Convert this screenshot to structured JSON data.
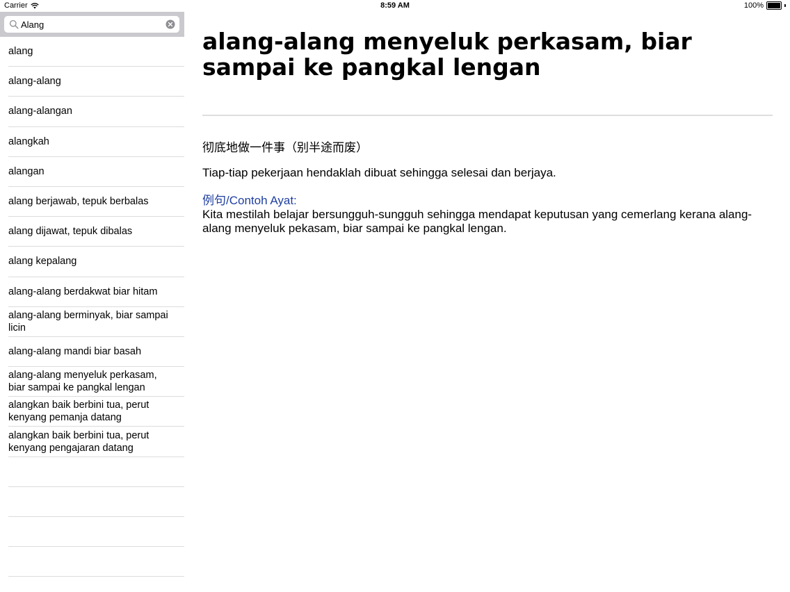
{
  "status_bar": {
    "carrier": "Carrier",
    "time": "8:59 AM",
    "battery": "100%",
    "battery_level": 1.0,
    "wifi_icon": "wifi-icon",
    "battery_icon": "battery-icon"
  },
  "search": {
    "value": "Alang",
    "placeholder": "",
    "search_icon": "search-icon",
    "clear_icon": "clear-icon"
  },
  "results": [
    "alang",
    "alang-alang",
    "alang-alangan",
    "alangkah",
    "alangan",
    "alang berjawab, tepuk berbalas",
    "alang dijawat, tepuk dibalas",
    "alang kepalang",
    "alang-alang berdakwat biar hitam",
    "alang-alang berminyak, biar sampai licin",
    "alang-alang mandi biar basah",
    "alang-alang menyeluk perkasam, biar sampai ke pangkal lengan",
    "alangkan baik berbini tua, perut kenyang pemanja datang",
    "alangkan baik berbini tua, perut kenyang pengajaran datang"
  ],
  "detail": {
    "headword": "alang-alang menyeluk perkasam, biar sampai ke pangkal lengan",
    "translation": "彻底地做一件事（别半途而废）",
    "definition": "Tiap-tiap pekerjaan hendaklah dibuat sehingga selesai dan berjaya.",
    "example_label": "例句/Contoh Ayat:",
    "example_text": "Kita mestilah belajar bersungguh-sungguh sehingga mendapat keputusan yang cemerlang kerana alang-alang menyeluk pekasam, biar sampai ke pangkal lengan."
  },
  "colors": {
    "search_bar_bg": "#c9c9ce",
    "example_label": "#1f3fa0",
    "divider": "#dedede"
  }
}
